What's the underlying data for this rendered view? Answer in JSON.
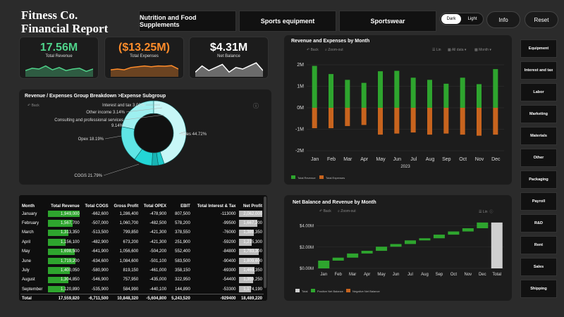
{
  "header": {
    "title_line1": "Fitness Co.",
    "title_line2": "Financial Report"
  },
  "categories": [
    "Nutrition and Food Supplements",
    "Sports equipment",
    "Sportswear"
  ],
  "theme_toggle": {
    "dark": "Dark",
    "light": "Light",
    "selected": "Dark"
  },
  "buttons": {
    "info": "Info",
    "reset": "Reset"
  },
  "kpis": [
    {
      "value": "17.56M",
      "label": "Total Revenue",
      "color": "#4fd38a",
      "spark": [
        0.4,
        0.55,
        0.5,
        0.7,
        0.45,
        0.6,
        0.4,
        0.5,
        0.55,
        0.35,
        0.5
      ]
    },
    {
      "value": "($13.25M)",
      "label": "Total Expenses",
      "color": "#ff8c2a",
      "spark": [
        0.45,
        0.5,
        0.45,
        0.6,
        0.65,
        0.7,
        0.65,
        0.7,
        0.68,
        0.72,
        0.5
      ]
    },
    {
      "value": "$4.31M",
      "label": "Net Balance",
      "color": "#ffffff",
      "spark": [
        0.3,
        0.7,
        0.4,
        0.6,
        0.8,
        0.3,
        0.6,
        0.5,
        0.7,
        0.9,
        0.4
      ]
    }
  ],
  "donut": {
    "title": "Revenue / Expenses Group Breakdown  >Expense Subgroup",
    "back": "Back",
    "labels": [
      "Interest and tax 3.02%",
      "Other income 3.14%",
      "Consulting and professional services",
      "9.14%",
      "Opex 18.19%",
      "COGS 21.79%",
      "Sales 44.72%"
    ],
    "chart_data": {
      "type": "pie",
      "categories": [
        "Sales",
        "COGS",
        "Opex",
        "Consulting and professional services",
        "Other income",
        "Interest and tax"
      ],
      "values": [
        44.72,
        21.79,
        18.19,
        9.14,
        3.14,
        3.02
      ]
    }
  },
  "revexp": {
    "title": "Revenue and Expenses by Month",
    "back": "Back",
    "zoom": "Zoom-out",
    "controls": [
      "Lin",
      "All data",
      "Month"
    ],
    "year": "2023",
    "legend": [
      "Total Revenue",
      "Total Expenses"
    ],
    "colors": {
      "revenue": "#2ea52e",
      "expenses": "#c8641e"
    },
    "chart_data": {
      "type": "bar",
      "categories": [
        "Jan",
        "Feb",
        "Mar",
        "Apr",
        "May",
        "Jun",
        "Jul",
        "Aug",
        "Sep",
        "Oct",
        "Nov",
        "Dec"
      ],
      "series": [
        {
          "name": "Total Revenue",
          "values": [
            1.95,
            1.57,
            1.3,
            1.16,
            1.7,
            1.72,
            1.4,
            1.3,
            1.12,
            1.4,
            1.1,
            1.8
          ]
        },
        {
          "name": "Total Expenses",
          "values": [
            -0.95,
            -0.95,
            -0.85,
            -0.8,
            -1.25,
            -1.2,
            -1.15,
            -1.25,
            -1.2,
            -1.25,
            -1.3,
            -1.25
          ]
        }
      ],
      "yticks": [
        "2M",
        "1M",
        "0M",
        "-1M",
        "-2M"
      ],
      "ylim": [
        -2,
        2
      ]
    }
  },
  "waterfall": {
    "title": "Net Balance and Revenue by Month",
    "back": "Back",
    "zoom": "Zoom-out",
    "lin": "Lin",
    "legend": [
      "Total",
      "Positive Net Balance",
      "Negative Net Balance"
    ],
    "chart_data": {
      "type": "bar",
      "categories": [
        "Jan",
        "Feb",
        "Mar",
        "Apr",
        "May",
        "Jun",
        "Jul",
        "Aug",
        "Sep",
        "Oct",
        "Nov",
        "Dec",
        "Total"
      ],
      "values": [
        0.73,
        0.28,
        0.39,
        0.25,
        0.39,
        0.25,
        0.34,
        0.2,
        0.34,
        0.3,
        0.3,
        0.54,
        4.31
      ],
      "yticks": [
        "$4.00M",
        "$2.00M",
        "$0.00M"
      ],
      "ylim": [
        0,
        4.5
      ]
    }
  },
  "table": {
    "headers": [
      "Month",
      "Total Revenue",
      "Total COGS",
      "Gross Profit",
      "Total OPEX",
      "EBIT",
      "Total Interest & Tax",
      "Net Profit"
    ],
    "rows": [
      [
        "January",
        "1,949,000",
        "-662,600",
        "1,286,400",
        "-478,900",
        "807,500",
        "-113000",
        "2,062,000"
      ],
      [
        "February",
        "1,567,700",
        "-507,000",
        "1,060,700",
        "-482,500",
        "578,200",
        "-99500",
        "1,667,200"
      ],
      [
        "March",
        "1,313,350",
        "-513,500",
        "799,850",
        "-421,300",
        "378,550",
        "-76000",
        "1,389,350"
      ],
      [
        "April",
        "1,156,100",
        "-482,900",
        "673,200",
        "-421,300",
        "251,900",
        "-59200",
        "1,215,300"
      ],
      [
        "May",
        "1,698,500",
        "-641,900",
        "1,056,600",
        "-504,200",
        "552,400",
        "-84800",
        "1,783,300"
      ],
      [
        "June",
        "1,719,200",
        "-634,600",
        "1,084,600",
        "-501,100",
        "583,500",
        "-90400",
        "1,809,600"
      ],
      [
        "July",
        "1,400,050",
        "-580,900",
        "819,150",
        "-461,000",
        "358,150",
        "-69300",
        "1,469,350"
      ],
      [
        "August",
        "1,304,850",
        "-546,900",
        "757,950",
        "-435,000",
        "322,950",
        "-54400",
        "1,359,250"
      ],
      [
        "September",
        "1,120,890",
        "-535,900",
        "584,990",
        "-440,100",
        "144,890",
        "-53300",
        "1,174,190"
      ]
    ],
    "revenue_fraction": [
      1.0,
      0.8,
      0.67,
      0.59,
      0.87,
      0.88,
      0.72,
      0.67,
      0.58
    ],
    "netprofit_fraction": [
      1.0,
      0.81,
      0.67,
      0.59,
      0.86,
      0.88,
      0.71,
      0.66,
      0.57
    ],
    "total": [
      "Total",
      "17,559,820",
      "-6,711,500",
      "10,848,320",
      "-5,604,800",
      "5,243,520",
      "-929400",
      "18,489,220"
    ]
  },
  "sidebar": [
    "Equipment",
    "Interest and tax",
    "Labor",
    "Marketing",
    "Materials",
    "Other",
    "Packaging",
    "Payroll",
    "R&D",
    "Rent",
    "Sales",
    "Shipping"
  ]
}
